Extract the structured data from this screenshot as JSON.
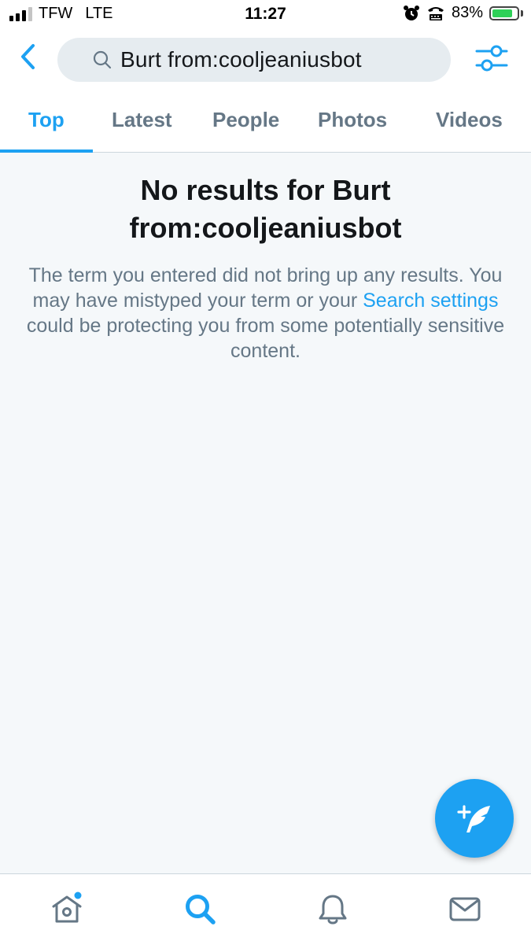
{
  "status_bar": {
    "carrier": "TFW",
    "network": "LTE",
    "time": "11:27",
    "battery": "83%",
    "battery_level": 0.83
  },
  "search": {
    "query": "Burt from:cooljeaniusbot"
  },
  "tabs": [
    {
      "label": "Top",
      "active": true
    },
    {
      "label": "Latest"
    },
    {
      "label": "People"
    },
    {
      "label": "Photos"
    },
    {
      "label": "Videos"
    }
  ],
  "empty_state": {
    "title": "No results for Burt from:cooljeaniusbot",
    "desc_part1": "The term you entered did not bring up any results. You may have mistyped your term or your ",
    "link_text": "Search settings",
    "desc_part2": " could be protecting you from some potentially sensitive content."
  },
  "icons": {
    "back": "chevron-left-icon",
    "search": "search-icon",
    "filter": "filter-icon",
    "compose": "compose-tweet-icon",
    "home": "home-icon",
    "explore": "search-icon",
    "notifications": "bell-icon",
    "messages": "mail-icon"
  },
  "colors": {
    "accent": "#1da1f2",
    "muted": "#657786",
    "background": "#f5f8fa"
  }
}
